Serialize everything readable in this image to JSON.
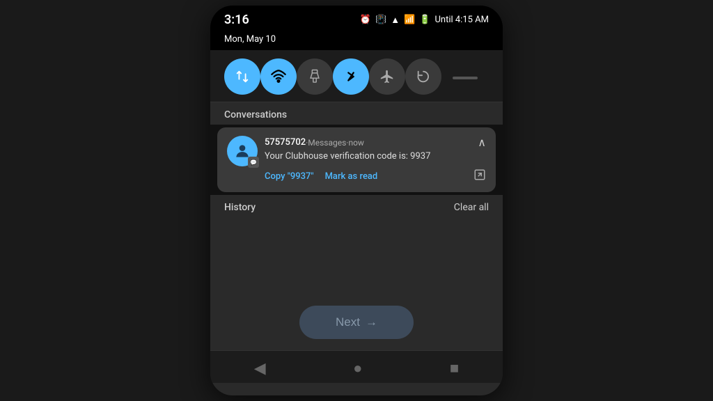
{
  "statusBar": {
    "time": "3:16",
    "date": "Mon, May 10",
    "untilText": "Until 4:15 AM"
  },
  "quickTiles": [
    {
      "icon": "⇅",
      "active": true,
      "name": "data-transfer"
    },
    {
      "icon": "WiFi",
      "active": true,
      "name": "wifi"
    },
    {
      "icon": "🔦",
      "active": false,
      "name": "flashlight"
    },
    {
      "icon": "Bluetooth",
      "active": true,
      "name": "bluetooth"
    },
    {
      "icon": "✈",
      "active": false,
      "name": "airplane"
    },
    {
      "icon": "↻",
      "active": false,
      "name": "rotate"
    }
  ],
  "sections": {
    "conversations": "Conversations",
    "history": "History",
    "clearAll": "Clear all"
  },
  "notification": {
    "sender": "57575702",
    "app": "Messages",
    "time": "now",
    "body": "Your Clubhouse verification code is: 9937",
    "actions": {
      "copy": "Copy \"9937\"",
      "markRead": "Mark as read"
    }
  },
  "nextButton": {
    "label": "Next",
    "arrow": "→"
  },
  "bottomNav": {
    "items": [
      "◀",
      "●",
      "■"
    ]
  }
}
